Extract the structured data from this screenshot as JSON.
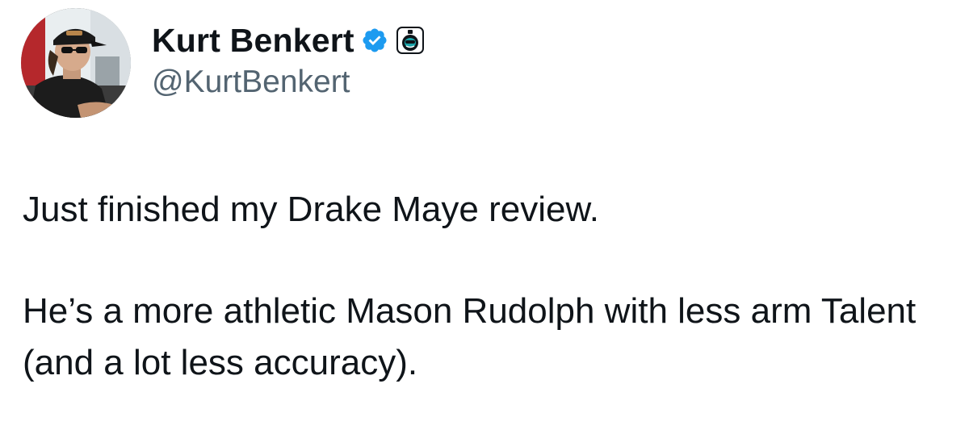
{
  "author": {
    "display_name": "Kurt Benkert",
    "handle": "@KurtBenkert",
    "verified_icon": "verified-badge-icon",
    "affiliate_icon": "affiliate-badge-icon",
    "avatar": "profile-photo"
  },
  "tweet": {
    "line1": "Just finished my Drake Maye review.",
    "line2": "He’s a more athletic Mason Rudolph with less arm Talent (and a lot less accuracy)."
  },
  "colors": {
    "text": "#0f1419",
    "secondary_text": "#536471",
    "verified_blue": "#1d9bf0",
    "background": "#ffffff"
  }
}
